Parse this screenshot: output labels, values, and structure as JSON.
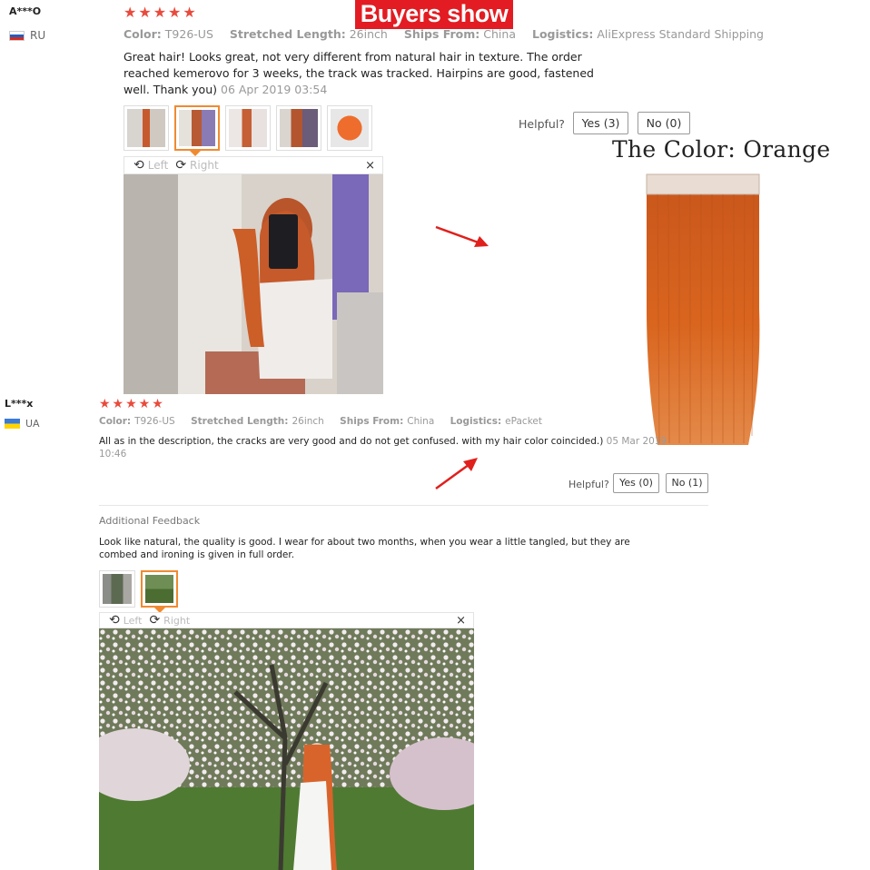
{
  "banner": {
    "title": "Buyers show"
  },
  "color_label": "The Color: Orange",
  "review1": {
    "user": "A***O",
    "country": "RU",
    "stars": "★★★★★",
    "meta": {
      "color_key": "Color:",
      "color_val": "T926-US",
      "length_key": "Stretched Length:",
      "length_val": "26inch",
      "ships_key": "Ships From:",
      "ships_val": "China",
      "logistics_key": "Logistics:",
      "logistics_val": "AliExpress Standard Shipping"
    },
    "text_l1": "Great hair! Looks great, not very different from natural hair in texture. The order",
    "text_l2": "reached kemerovo for 3 weeks, the track was tracked. Hairpins are good, fastened",
    "text_l3": "well. Thank you)",
    "timestamp": "06 Apr 2019 03:54",
    "viewer": {
      "left": "Left",
      "right": "Right",
      "close": "×"
    },
    "helpful": {
      "label": "Helpful?",
      "yes": "Yes (3)",
      "no": "No (0)"
    }
  },
  "review2": {
    "user": "L***x",
    "country": "UA",
    "stars": "★★★★★",
    "meta": {
      "color_key": "Color:",
      "color_val": "T926-US",
      "length_key": "Stretched Length:",
      "length_val": "26inch",
      "ships_key": "Ships From:",
      "ships_val": "China",
      "logistics_key": "Logistics:",
      "logistics_val": "ePacket"
    },
    "text": "All as in the description, the cracks are very good and do not get confused. with my hair color coincided.)",
    "timestamp_a": "05 Mar 2019",
    "timestamp_b": "10:46",
    "helpful": {
      "label": "Helpful?",
      "yes": "Yes (0)",
      "no": "No (1)"
    },
    "additional_title": "Additional Feedback",
    "additional_l1": "Look like natural, the quality is good. I wear for about two months, when you wear a little tangled, but they are",
    "additional_l2": "combed and ironing is given in full order.",
    "viewer": {
      "left": "Left",
      "right": "Right",
      "close": "×"
    }
  },
  "colors": {
    "banner_red": "#e21c22",
    "star_red": "#e84b3c",
    "selected_border": "#f08a30",
    "arrow_red": "#e0201c",
    "hair_orange": "#d9651e"
  },
  "icons": [
    "rotate-left-icon",
    "rotate-right-icon",
    "close-icon",
    "flag-ru-icon",
    "flag-ua-icon",
    "arrow-icon"
  ]
}
